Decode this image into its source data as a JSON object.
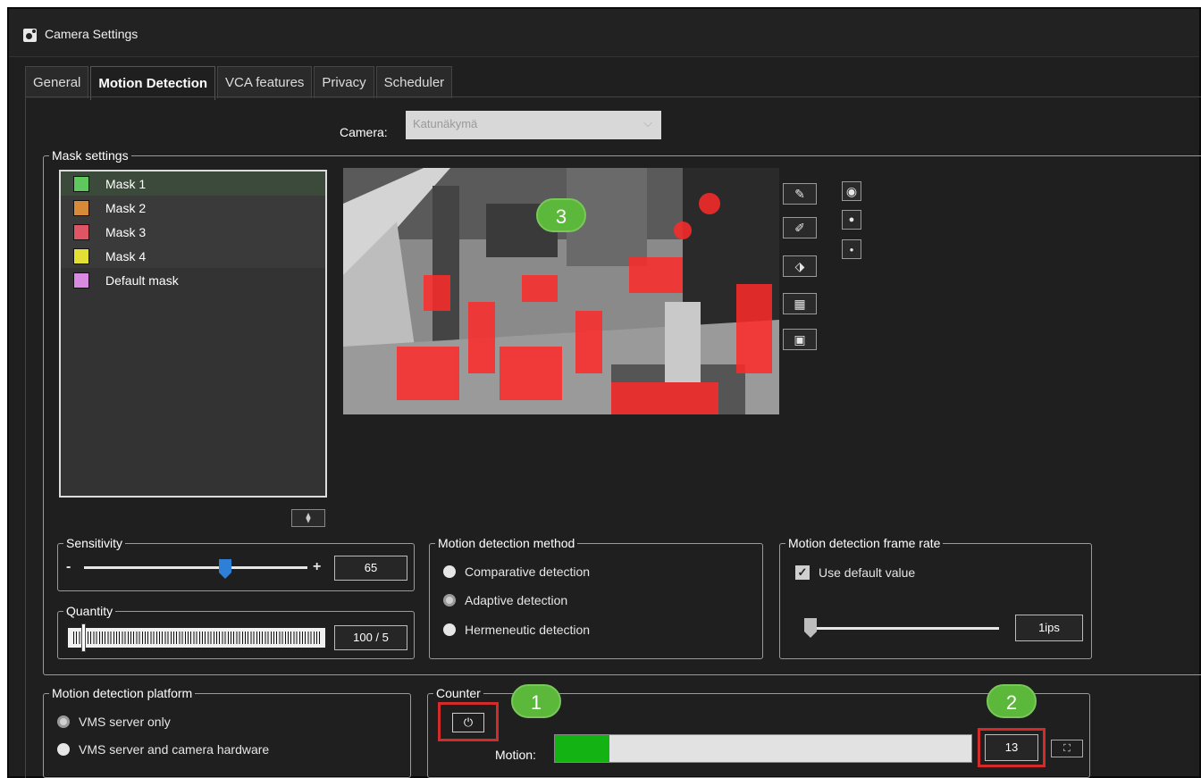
{
  "window": {
    "title": "Camera Settings"
  },
  "tabs": [
    {
      "label": "General",
      "active": false
    },
    {
      "label": "Motion Detection",
      "active": true
    },
    {
      "label": "VCA features",
      "active": false
    },
    {
      "label": "Privacy",
      "active": false
    },
    {
      "label": "Scheduler",
      "active": false
    }
  ],
  "camera": {
    "label": "Camera:",
    "value": "Katunäkymä"
  },
  "mask_settings": {
    "legend": "Mask settings",
    "masks": [
      {
        "label": "Mask 1",
        "color": "#5ec85e"
      },
      {
        "label": "Mask 2",
        "color": "#d98a38"
      },
      {
        "label": "Mask 3",
        "color": "#e05565"
      },
      {
        "label": "Default mask",
        "color": "#d88ae0"
      }
    ],
    "mask4": {
      "label": "Mask 4",
      "color": "#e2e034"
    }
  },
  "sensitivity": {
    "legend": "Sensitivity",
    "minus": "-",
    "plus": "+",
    "value": "65",
    "level_percent": 65
  },
  "quantity": {
    "legend": "Quantity",
    "value": "100 / 5"
  },
  "method": {
    "legend": "Motion detection method",
    "options": [
      "Comparative detection",
      "Adaptive detection",
      "Hermeneutic detection"
    ],
    "selected": "Adaptive detection"
  },
  "frame_rate": {
    "legend": "Motion detection frame rate",
    "checkbox_label": "Use default value",
    "checked": true,
    "value": "1ips"
  },
  "platform": {
    "legend": "Motion detection platform",
    "options": [
      "VMS server only",
      "VMS server and camera hardware"
    ],
    "selected": "VMS server only"
  },
  "counter": {
    "legend": "Counter",
    "motion_label": "Motion:",
    "value": "13",
    "level_percent": 13
  },
  "badges": [
    "1",
    "2",
    "3"
  ],
  "colors": {
    "accent_green": "#5cb83a",
    "highlight_red": "#d32a2a",
    "motion_bar": "#12b312"
  }
}
